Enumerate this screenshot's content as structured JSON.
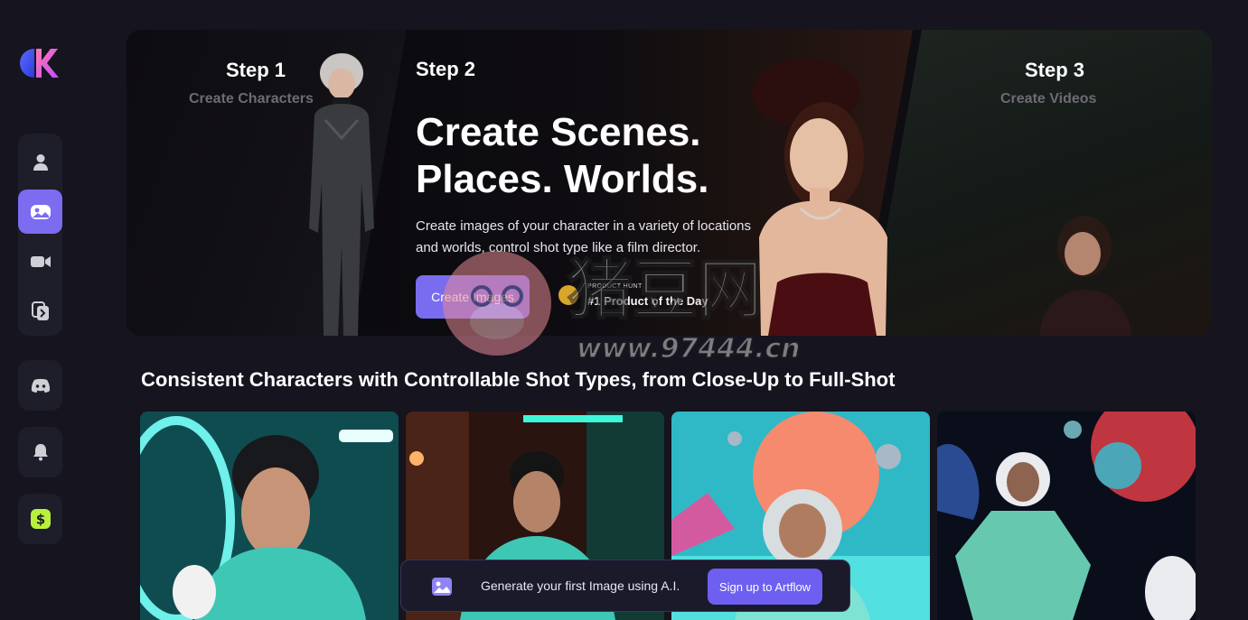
{
  "sidebar": {
    "logo": "artflow-logo",
    "nav_items": [
      {
        "icon": "user-icon",
        "active": false
      },
      {
        "icon": "image-scene-icon",
        "active": true
      },
      {
        "icon": "video-camera-icon",
        "active": false
      },
      {
        "icon": "copy-icon",
        "active": false
      }
    ],
    "discord_icon": "discord-icon",
    "notification_icon": "bell-icon",
    "pricing_icon": "dollar-icon"
  },
  "hero": {
    "step1": {
      "title": "Step 1",
      "subtitle": "Create Characters"
    },
    "step2": {
      "title": "Step 2"
    },
    "step3": {
      "title": "Step 3",
      "subtitle": "Create Videos"
    },
    "headline_line1": "Create Scenes.",
    "headline_line2": "Places. Worlds.",
    "description_line1": "Create images of your character in a variety of locations",
    "description_line2": "and worlds, control shot type like a film director.",
    "cta_label": "Create Images",
    "badge_small": "PRODUCT HUNT",
    "badge_big": "#1 Product of the Day"
  },
  "section": {
    "title": "Consistent Characters with Controllable Shot Types, from Close-Up to Full-Shot"
  },
  "gallery": {
    "cards": [
      {
        "name": "close-up-astronaut"
      },
      {
        "name": "bar-astronaut"
      },
      {
        "name": "alien-planet-astronaut"
      },
      {
        "name": "space-full-shot-astronaut"
      }
    ]
  },
  "signup_bar": {
    "text": "Generate your first Image using A.I.",
    "button_label": "Sign up to Artflow"
  },
  "watermark": {
    "text_cn": "猪豆网",
    "url": "www.97444.cn"
  },
  "colors": {
    "accent": "#7a6cee",
    "background": "#15141f",
    "sidebar_group": "#1e1d2a",
    "teal_suit": "#3fc7b6"
  }
}
